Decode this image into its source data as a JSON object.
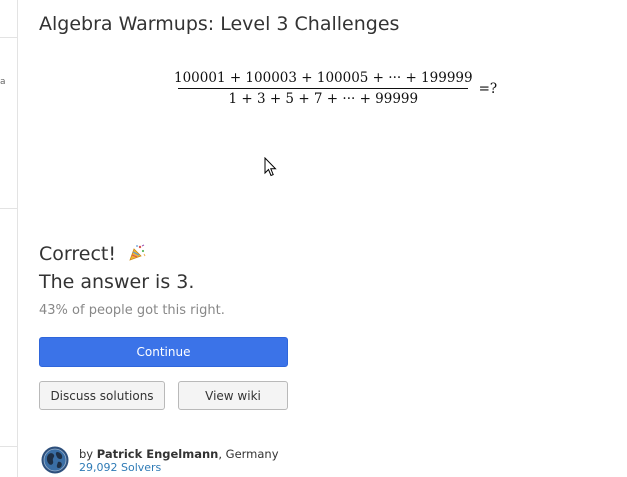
{
  "sidebar": {
    "peek_text": "a"
  },
  "problem": {
    "title": "Algebra Warmups: Level 3 Challenges",
    "equation": {
      "numerator": "100001 + 100003 + 100005 + ··· + 199999",
      "denominator": "1 + 3 + 5 + 7 + ··· + 99999",
      "rhs": "=?"
    }
  },
  "result": {
    "status": "Correct!",
    "status_icon": "party-popper-icon",
    "answer": "The answer is 3.",
    "stat": "43% of people got this right."
  },
  "buttons": {
    "continue": "Continue",
    "discuss": "Discuss solutions",
    "wiki": "View wiki"
  },
  "author": {
    "by": "by",
    "name": "Patrick Engelmann",
    "location": ", Germany",
    "solvers": "29,092 Solvers"
  },
  "colors": {
    "primary": "#3b73e8",
    "link": "#2f7bb6",
    "muted": "#888888"
  }
}
